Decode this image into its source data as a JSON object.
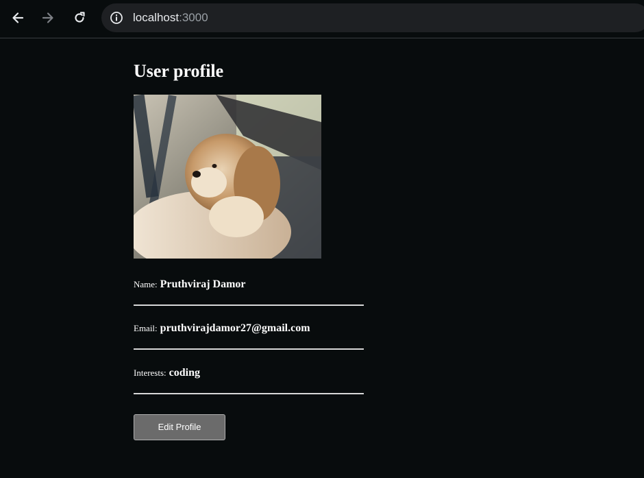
{
  "browser": {
    "address_host": "localhost",
    "address_port": ":3000"
  },
  "profile": {
    "title": "User profile",
    "avatar_alt": "dog photo",
    "fields": [
      {
        "label": "Name:",
        "value": "Pruthviraj Damor"
      },
      {
        "label": "Email:",
        "value": "pruthvirajdamor27@gmail.com"
      },
      {
        "label": "Interests:",
        "value": "coding"
      }
    ],
    "edit_label": "Edit Profile"
  },
  "colors": {
    "page_bg": "#080c0d",
    "button_bg": "#6b6b6b",
    "divider": "#d8d8d8"
  }
}
